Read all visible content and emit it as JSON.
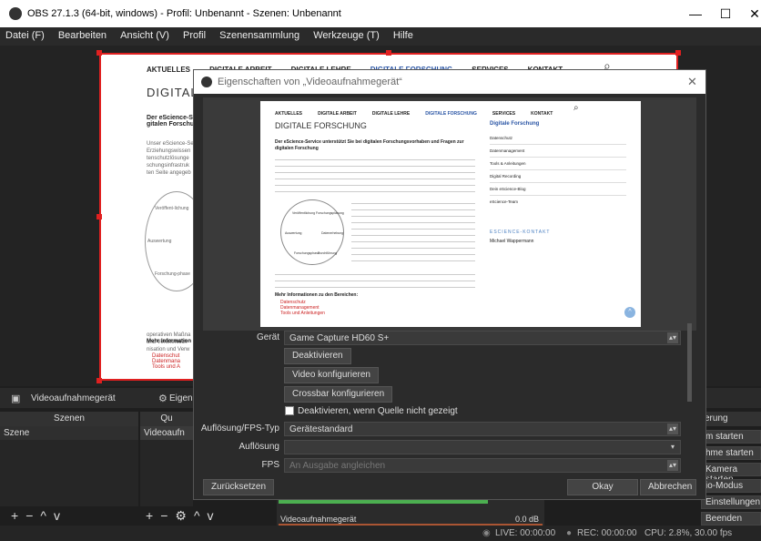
{
  "window": {
    "title": "OBS 27.1.3 (64-bit, windows) - Profil: Unbenannt - Szenen: Unbenannt",
    "minimize": "—",
    "maximize": "☐",
    "close": "✕"
  },
  "menu": [
    "Datei (F)",
    "Bearbeiten",
    "Ansicht (V)",
    "Profil",
    "Szenensammlung",
    "Werkzeuge (T)",
    "Hilfe"
  ],
  "preview_site": {
    "nav": [
      "AKTUELLES",
      "DIGITALE ARBEIT",
      "DIGITALE LEHRE",
      "DIGITALE FORSCHUNG",
      "SERVICES",
      "KONTAKT"
    ],
    "heading": "DIGITALE",
    "intro_bold": "Der eScience-Se gitalen Forschu",
    "body_lines": [
      "Unser eScience-Se",
      "Erziehungswissen",
      "tenschutzlösunge",
      "schungsinfrastruk",
      "ten Seite angegeb"
    ],
    "wheel_left": [
      "Veröffent-lichung",
      "Auswertung",
      "Forschung-phase"
    ],
    "lower_lines": [
      "operativen Maßna",
      "und Veröffentlich",
      "nisation und Verw"
    ],
    "more_info": "Mehr Information",
    "links": [
      "Datenschut",
      "Datenmana",
      "Tools und A"
    ]
  },
  "dialog": {
    "title": "Eigenschaften von „Videoaufnahmegerät“",
    "close": "✕",
    "inner_site": {
      "nav": [
        "AKTUELLES",
        "DIGITALE ARBEIT",
        "DIGITALE LEHRE",
        "DIGITALE FORSCHUNG",
        "SERVICES",
        "KONTAKT"
      ],
      "heading": "DIGITALE FORSCHUNG",
      "intro": "Der eScience-Service unterstützt Sie bei digitalen Forschungsvorhaben und Fragen zur digitalen Forschung",
      "sidebar_title": "Digitale Forschung",
      "sidebar_items": [
        "Datenschutz",
        "Datenmanagement",
        "Tools & Anleitungen",
        "Digital Recording",
        "Dein eScience-Blog",
        "eScience-Team"
      ],
      "contact_heading": "ESCIENCE-KONTAKT",
      "contact_name": "Michael Wappermann",
      "more_info": "Mehr Informationen zu den Bereichen:",
      "links": [
        "Datenschutz",
        "Datenmanagement",
        "Tools und Anleitungen"
      ],
      "wheel": [
        "Veröffentlichung",
        "Forschungsplanung",
        "Auswertung",
        "Datenerhebung",
        "Forschungsphase",
        "Durchführung"
      ]
    },
    "device_label": "Gerät",
    "device_value": "Game Capture HD60 S+",
    "btn_deactivate": "Deaktivieren",
    "btn_configure_video": "Video konfigurieren",
    "btn_crossbar": "Crossbar konfigurieren",
    "checkbox_label": "Deaktivieren, wenn Quelle nicht gezeigt",
    "res_fps_type_label": "Auflösung/FPS-Typ",
    "res_fps_type_value": "Gerätestandard",
    "resolution_label": "Auflösung",
    "resolution_value": "",
    "fps_label": "FPS",
    "fps_value": "An Ausgabe angleichen",
    "btn_reset": "Zurücksetzen",
    "btn_ok": "Okay",
    "btn_cancel": "Abbrechen"
  },
  "source_toolbar": {
    "source_name": "Videoaufnahmegerät",
    "properties": "Eigensc"
  },
  "scenes": {
    "header": "Szenen",
    "items": [
      "Szene"
    ]
  },
  "sources": {
    "header": "Qu",
    "items": [
      "Videoaufn"
    ]
  },
  "mixer": {
    "track_name": "Videoaufnahmegerät",
    "level": "0.0 dB"
  },
  "controls": {
    "header": "erung",
    "buttons": [
      "m starten",
      "hme starten",
      "Kamera starten",
      "io-Modus",
      "Einstellungen",
      "Beenden"
    ]
  },
  "statusbar": {
    "live": "LIVE: 00:00:00",
    "rec": "REC: 00:00:00",
    "cpu": "CPU: 2.8%, 30.00 fps"
  },
  "colors": {
    "accent": "#e02020",
    "nav_active": "#2a55a5"
  }
}
